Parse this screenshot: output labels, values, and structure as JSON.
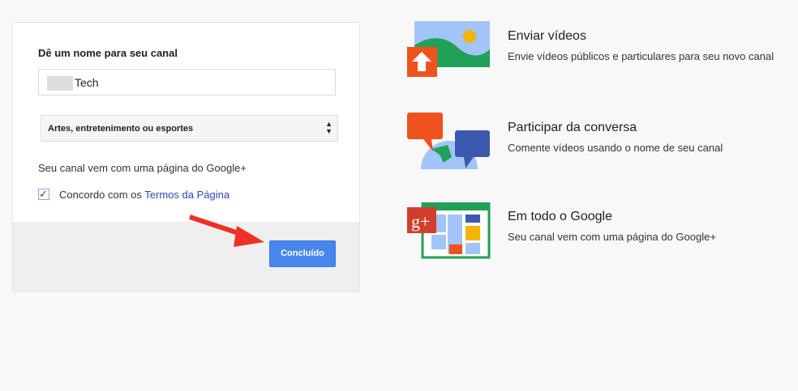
{
  "form": {
    "heading": "Dê um nome para seu canal",
    "name_value": "Tech",
    "category": "Artes, entretenimento ou esportes",
    "info": "Seu canal vem com uma página do Google+",
    "agree_text": "Concordo com os ",
    "agree_link": "Termos da Página",
    "checked": true,
    "submit": "Concluído"
  },
  "features": [
    {
      "title": "Enviar vídeos",
      "desc": "Envie vídeos públicos e particulares para seu novo canal"
    },
    {
      "title": "Participar da conversa",
      "desc": "Comente vídeos usando o nome de seu canal"
    },
    {
      "title": "Em todo o Google",
      "desc": "Seu canal vem com uma página do Google+"
    }
  ],
  "colors": {
    "button": "#4787ed",
    "arrow": "#ee3124",
    "link": "#3546b5"
  }
}
